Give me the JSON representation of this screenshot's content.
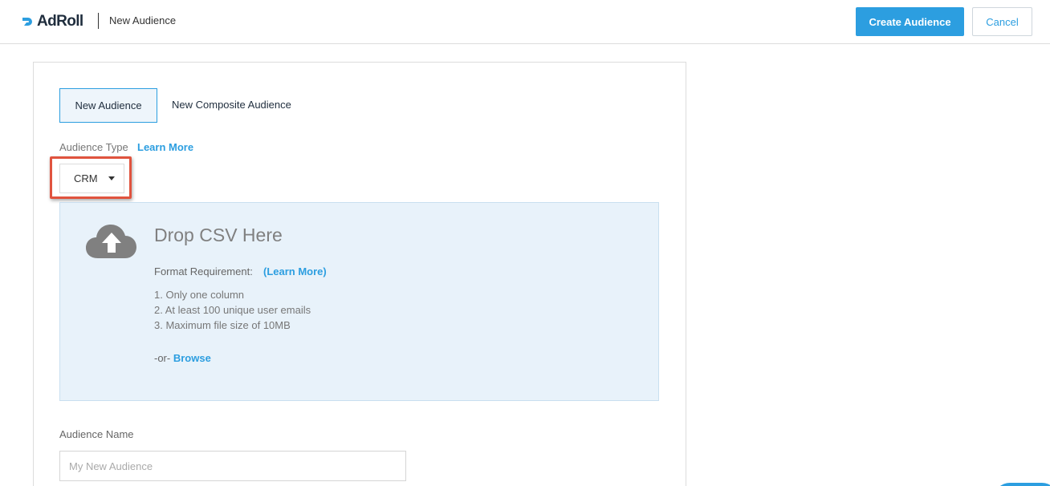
{
  "header": {
    "brand": "AdRoll",
    "title": "New Audience",
    "primary_button": "Create Audience",
    "cancel_button": "Cancel"
  },
  "tabs": [
    {
      "label": "New Audience",
      "active": true
    },
    {
      "label": "New Composite Audience",
      "active": false
    }
  ],
  "audience_type": {
    "label": "Audience Type",
    "learn_more": "Learn More",
    "selected": "CRM"
  },
  "dropzone": {
    "title": "Drop CSV Here",
    "format_label": "Format Requirement:",
    "format_link": "(Learn More)",
    "requirements": [
      "1. Only one column",
      "2. At least 100 unique user emails",
      "3. Maximum file size of 10MB"
    ],
    "or_text": "-or-",
    "browse": "Browse",
    "icon": "cloud-upload-icon"
  },
  "audience_name": {
    "label": "Audience Name",
    "placeholder": "My New Audience"
  },
  "colors": {
    "accent": "#2c9ee0",
    "highlight": "#e0533e",
    "dropzone_bg": "#e8f2fa"
  }
}
